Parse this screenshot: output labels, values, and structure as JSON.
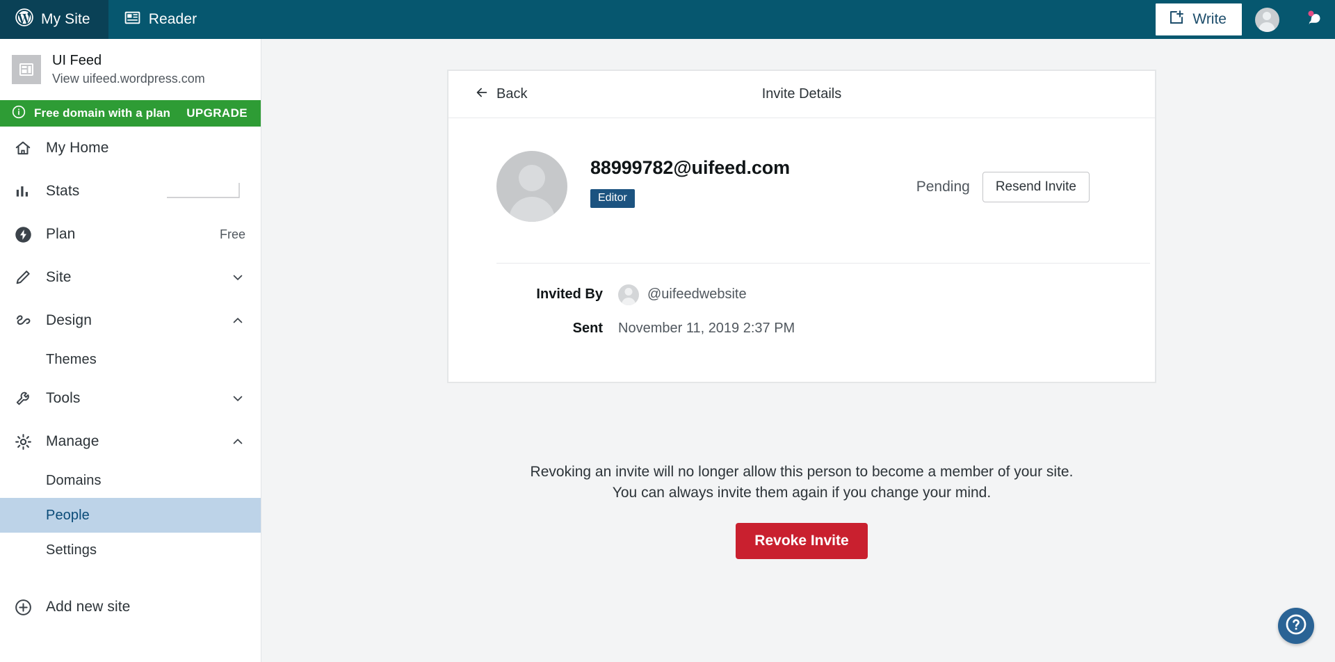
{
  "masthead": {
    "my_site_label": "My Site",
    "reader_label": "Reader",
    "write_label": "Write",
    "wordpress_icon": "wordpress-logo-icon",
    "reader_icon": "reader-icon",
    "write_icon": "write-page-plus-icon",
    "avatar_icon": "user-avatar-icon",
    "bell_icon": "notifications-bell-icon",
    "bell_badge_color": "#e34c84",
    "background_color": "#06576f",
    "active_tab_color": "#0a4156"
  },
  "sidebar": {
    "site": {
      "title": "UI Feed",
      "url_label": "View uifeed.wordpress.com",
      "thumb_icon": "site-thumbnail-icon"
    },
    "upgrade_banner": {
      "icon": "info-circle-icon",
      "label": "Free domain with a plan",
      "action": "UPGRADE",
      "color": "#2e9c35"
    },
    "items": [
      {
        "label": "My Home",
        "icon": "home-icon",
        "right": "",
        "chevron": ""
      },
      {
        "label": "Stats",
        "icon": "stats-bars-icon",
        "right": "",
        "chevron": "",
        "sparkline": true
      },
      {
        "label": "Plan",
        "icon": "plan-bolt-icon",
        "right": "Free",
        "chevron": ""
      },
      {
        "label": "Site",
        "icon": "pencil-icon",
        "right": "",
        "chevron": "down"
      },
      {
        "label": "Design",
        "icon": "design-brush-icon",
        "right": "",
        "chevron": "up"
      },
      {
        "label": "Tools",
        "icon": "wrench-icon",
        "right": "",
        "chevron": "down"
      },
      {
        "label": "Manage",
        "icon": "gear-icon",
        "right": "",
        "chevron": "up"
      }
    ],
    "design_children": [
      {
        "label": "Themes",
        "selected": false
      }
    ],
    "manage_children": [
      {
        "label": "Domains",
        "selected": false
      },
      {
        "label": "People",
        "selected": true
      },
      {
        "label": "Settings",
        "selected": false
      }
    ],
    "add_new_site": {
      "label": "Add new site",
      "icon": "plus-circle-icon"
    },
    "selected_color": "#bdd3e8",
    "selected_text_color": "#0a4b78"
  },
  "invite_card": {
    "back_label": "Back",
    "back_icon": "arrow-left-icon",
    "title": "Invite Details",
    "invitee": {
      "email": "88999782@uifeed.com",
      "role_badge": "Editor",
      "role_badge_color": "#1c5380",
      "avatar_icon": "invitee-avatar-icon"
    },
    "status": {
      "text": "Pending",
      "resend_label": "Resend Invite"
    },
    "meta": [
      {
        "label": "Invited By",
        "value": "@uifeedwebsite",
        "has_avatar": true
      },
      {
        "label": "Sent",
        "value": "November 11, 2019 2:37 PM",
        "has_avatar": false
      }
    ]
  },
  "revoke": {
    "line1": "Revoking an invite will no longer allow this person to become a member of your site.",
    "line2": "You can always invite them again if you change your mind.",
    "button_label": "Revoke Invite",
    "button_color": "#c9202f"
  },
  "help": {
    "icon": "help-question-icon",
    "color": "#2a6395"
  }
}
